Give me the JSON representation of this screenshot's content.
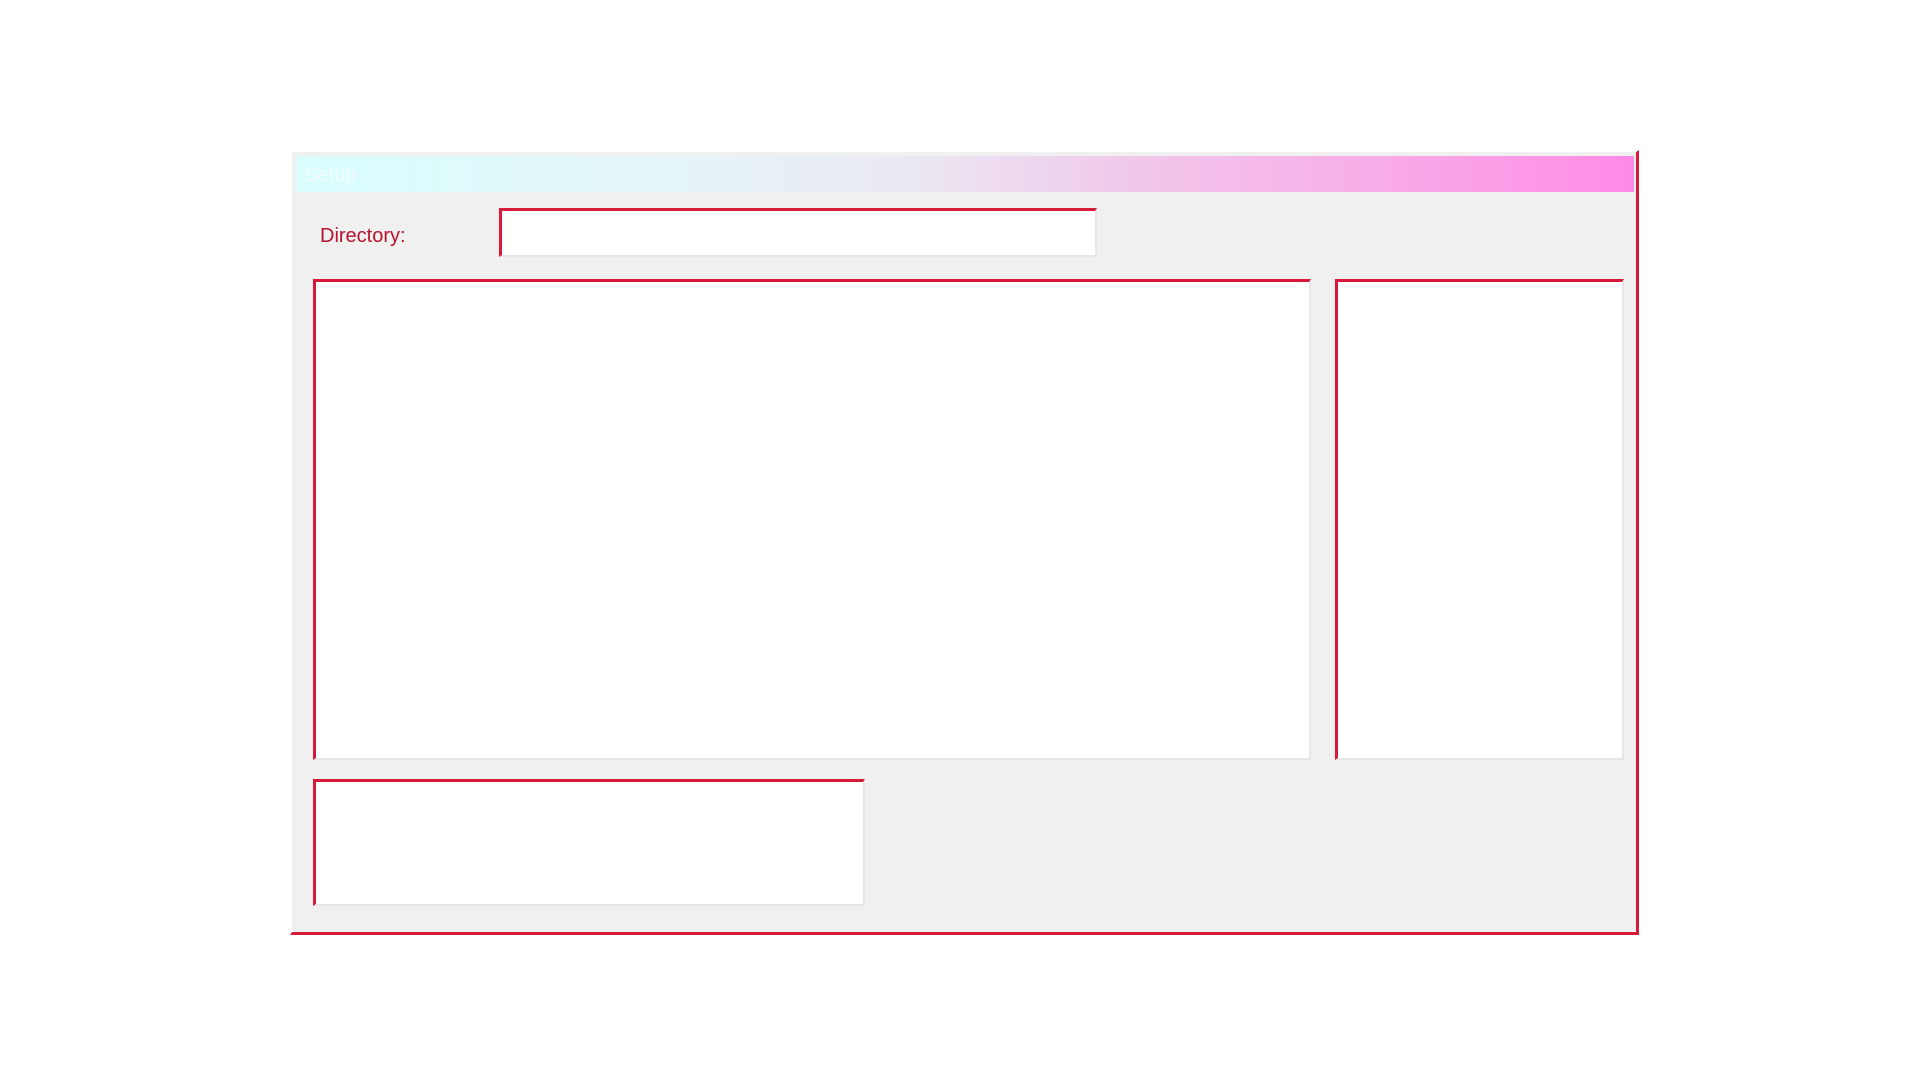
{
  "window": {
    "title": "Setup"
  },
  "form": {
    "directory_label": "Directory:",
    "directory_value": ""
  },
  "colors": {
    "accent": "#d7193a",
    "label_text": "#b3152f",
    "window_bg": "#f0f0f0",
    "title_gradient_start": "#d9fdfd",
    "title_gradient_end": "#ff8ae6"
  }
}
